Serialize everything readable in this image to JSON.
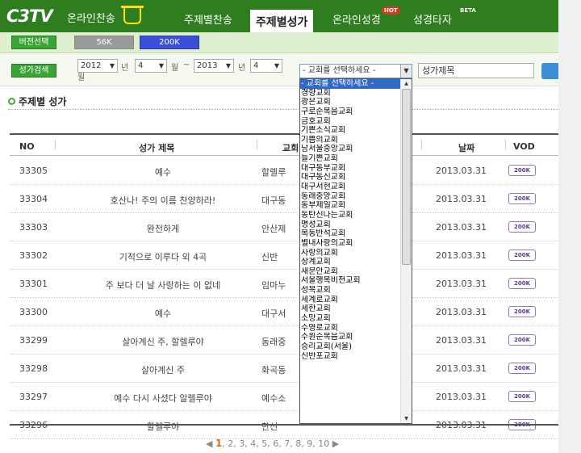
{
  "nav": {
    "logo": "C3TV",
    "logo_sub": "온라인찬송",
    "items": [
      {
        "label": "주제별찬송"
      },
      {
        "label": "주제별성가"
      },
      {
        "label": "온라인성경"
      },
      {
        "label": "성경타자"
      }
    ],
    "hot_badge": "HOT",
    "beta_badge": "BETA"
  },
  "subbar": {
    "version_label": "버전선택",
    "k56_label": "56K",
    "k200_label": "200K"
  },
  "search": {
    "button_label": "성가검색",
    "from_year": "2012",
    "from_month": "4",
    "to_year": "2013",
    "to_month": "4",
    "year_unit": "년",
    "month_unit": "월",
    "tilde": "~",
    "church_selected": "- 교회를 선택하세요 -",
    "title_placeholder": "성가제목"
  },
  "section": {
    "title": "주제별 성가"
  },
  "table": {
    "headers": {
      "no": "NO",
      "title": "성가 제목",
      "church": "교회",
      "date": "날짜",
      "vod": "VOD"
    },
    "vod_label": "200K",
    "rows": [
      {
        "no": "33305",
        "title": "예수",
        "church": "할렐루",
        "date": "2013.03.31"
      },
      {
        "no": "33304",
        "title": "호산나! 주의 이름 찬양하라!",
        "church": "대구동",
        "date": "2013.03.31"
      },
      {
        "no": "33303",
        "title": "완전하게",
        "church": "안산제",
        "date": "2013.03.31"
      },
      {
        "no": "33302",
        "title": "기적으로 이루다 외 4곡",
        "church": "신반",
        "date": "2013.03.31"
      },
      {
        "no": "33301",
        "title": "주 보다 더 날 사랑하는 이 없네",
        "church": "임마누",
        "date": "2013.03.31"
      },
      {
        "no": "33300",
        "title": "예수",
        "church": "대구서",
        "date": "2013.03.31"
      },
      {
        "no": "33299",
        "title": "살아계신 주, 할렐루야",
        "church": "동래중",
        "date": "2013.03.31"
      },
      {
        "no": "33298",
        "title": "살아계신 주",
        "church": "화곡동",
        "date": "2013.03.31"
      },
      {
        "no": "33297",
        "title": "예수 다시 사셨다 알렐루야",
        "church": "예수소",
        "date": "2013.03.31"
      },
      {
        "no": "33296",
        "title": "할렐루야",
        "church": "한신",
        "date": "2013.03.31"
      }
    ]
  },
  "dropdown": {
    "options": [
      "- 교회를 선택하세요 -",
      "경향교회",
      "광은교회",
      "구로순복음교회",
      "금호교회",
      "기쁜소식교회",
      "기쁨의교회",
      "남서울중앙교회",
      "늘기쁜교회",
      "대구동부교회",
      "대구동신교회",
      "대구서현교회",
      "동래중앙교회",
      "동부제일교회",
      "동탄신나는교회",
      "명성교회",
      "목동반석교회",
      "별내사랑의교회",
      "사랑의교회",
      "상계교회",
      "새문안교회",
      "서울행복비전교회",
      "성복교회",
      "세계로교회",
      "세한교회",
      "소망교회",
      "수영로교회",
      "수원순복음교회",
      "승리교회(서울)",
      "신반포교회"
    ]
  },
  "pager": {
    "current": "1",
    "rest": ", 2, 3, 4, 5, 6, 7, 8, 9, 10",
    "prev": "◀",
    "next": "▶"
  }
}
